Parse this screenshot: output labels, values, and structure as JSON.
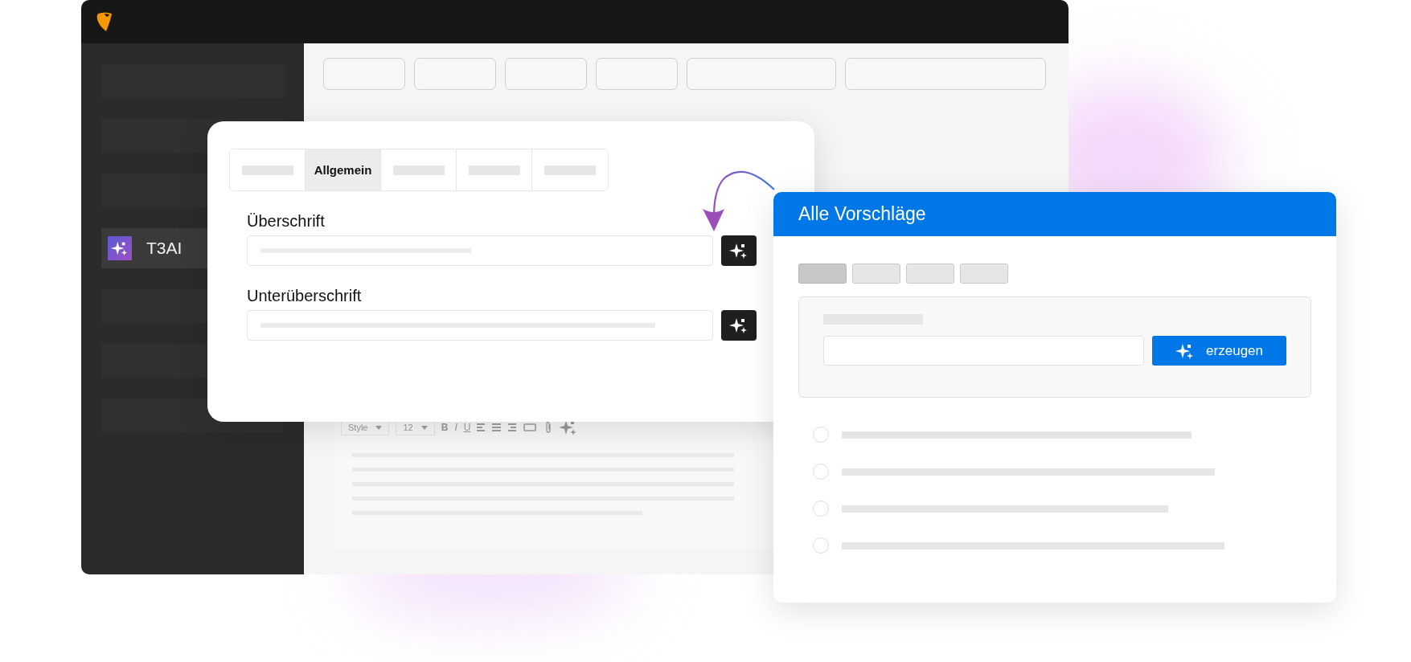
{
  "sidebar": {
    "items": [
      {
        "kind": "placeholder",
        "selected": false
      },
      {
        "kind": "placeholder",
        "selected": false
      },
      {
        "kind": "placeholder",
        "selected": false
      },
      {
        "kind": "app",
        "label": "T3AI",
        "selected": true
      },
      {
        "kind": "placeholder",
        "selected": false
      },
      {
        "kind": "placeholder",
        "selected": false
      },
      {
        "kind": "placeholder",
        "selected": false
      }
    ]
  },
  "editor_toolbar": {
    "style": "Style",
    "size": "12",
    "bold": "B",
    "italic": "I",
    "underline": "U"
  },
  "content_dialog": {
    "tabs": [
      {
        "selected": false
      },
      {
        "label": "Allgemein",
        "selected": true
      },
      {
        "selected": false
      },
      {
        "selected": false
      },
      {
        "selected": false
      }
    ],
    "fields": [
      {
        "label": "Überschrift"
      },
      {
        "label": "Unterüberschrift"
      }
    ]
  },
  "suggestions_panel": {
    "title": "Alle Vorschläge",
    "tabs": [
      {
        "selected": true
      },
      {
        "selected": false
      },
      {
        "selected": false
      },
      {
        "selected": false
      }
    ],
    "generate_button": "erzeugen",
    "suggestions": [
      {
        "selected": false
      },
      {
        "selected": false
      },
      {
        "selected": false
      },
      {
        "selected": false
      }
    ]
  }
}
